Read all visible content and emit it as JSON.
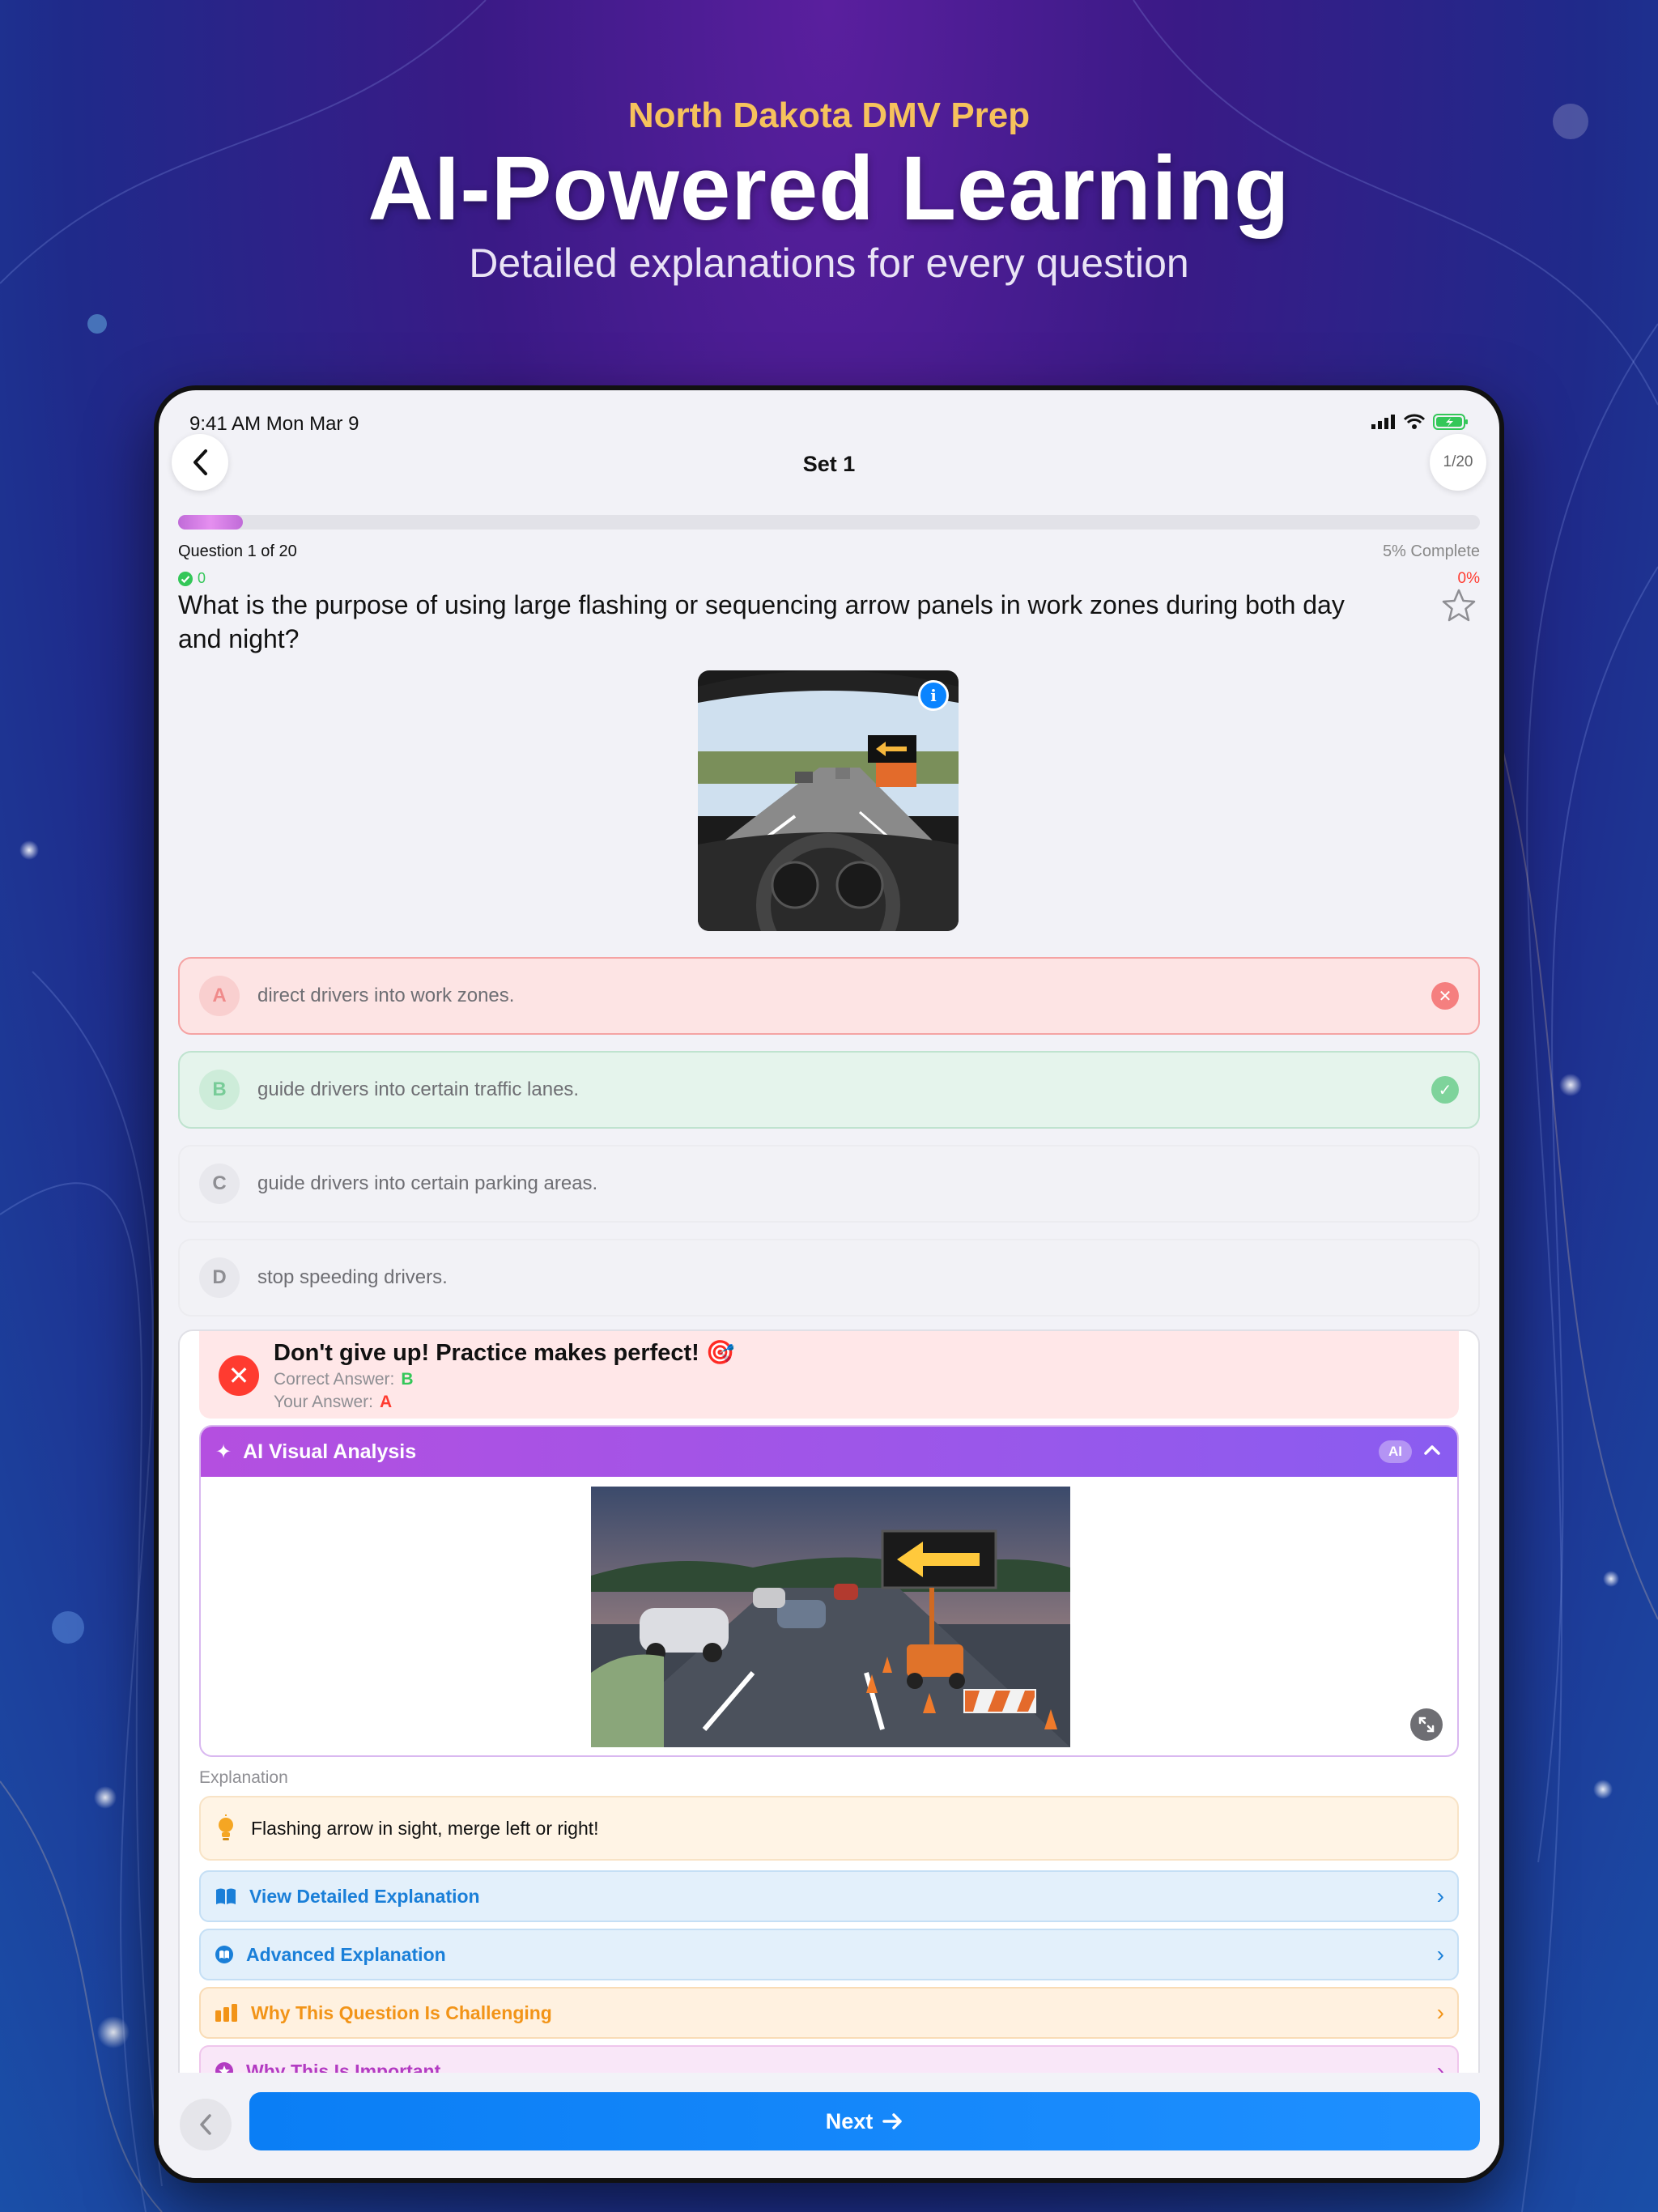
{
  "hero": {
    "kicker": "North Dakota DMV Prep",
    "title": "AI-Powered Learning",
    "subtitle": "Detailed explanations for every question"
  },
  "status_bar": {
    "time": "9:41 AM   Mon Mar 9"
  },
  "nav": {
    "title": "Set 1",
    "counter": "1/20"
  },
  "progress": {
    "fraction": 0.05,
    "question_label": "Question 1 of 20",
    "complete_label": "5% Complete",
    "correct_count": "0",
    "score_label": "0%"
  },
  "question": {
    "text": "What is the purpose of using large flashing or sequencing arrow panels in work zones during both day and night?"
  },
  "options": [
    {
      "letter": "A",
      "text": "direct drivers into work zones.",
      "state": "wrong"
    },
    {
      "letter": "B",
      "text": "guide drivers into certain traffic lanes.",
      "state": "correct"
    },
    {
      "letter": "C",
      "text": "guide drivers into certain parking areas.",
      "state": "neutral"
    },
    {
      "letter": "D",
      "text": "stop speeding drivers.",
      "state": "neutral"
    }
  ],
  "feedback": {
    "message": "Don't give up! Practice makes perfect! 🎯",
    "correct_label": "Correct Answer:",
    "correct_value": "B",
    "your_label": "Your Answer:",
    "your_value": "A"
  },
  "ai_panel": {
    "title": "AI Visual Analysis",
    "badge": "AI"
  },
  "explanation": {
    "label": "Explanation",
    "tip": "Flashing arrow in sight, merge left or right!",
    "links": [
      {
        "label": "View Detailed Explanation",
        "icon": "book-icon",
        "color": "#1a7fd8"
      },
      {
        "label": "Advanced Explanation",
        "icon": "book-circle-icon",
        "color": "#1a7fd8"
      },
      {
        "label": "Why This Question Is Challenging",
        "icon": "bar-chart-icon",
        "color": "#f29418"
      },
      {
        "label": "Why This Is Important",
        "icon": "star-circle-icon",
        "color": "#b33bc2"
      }
    ]
  },
  "footer": {
    "next_label": "Next"
  },
  "colors": {
    "accent": "#0a84ff",
    "wrong": "#ff3b30",
    "correct": "#34c759",
    "ai_gradient_start": "#b44fe0",
    "ai_gradient_end": "#8a5cf0"
  }
}
